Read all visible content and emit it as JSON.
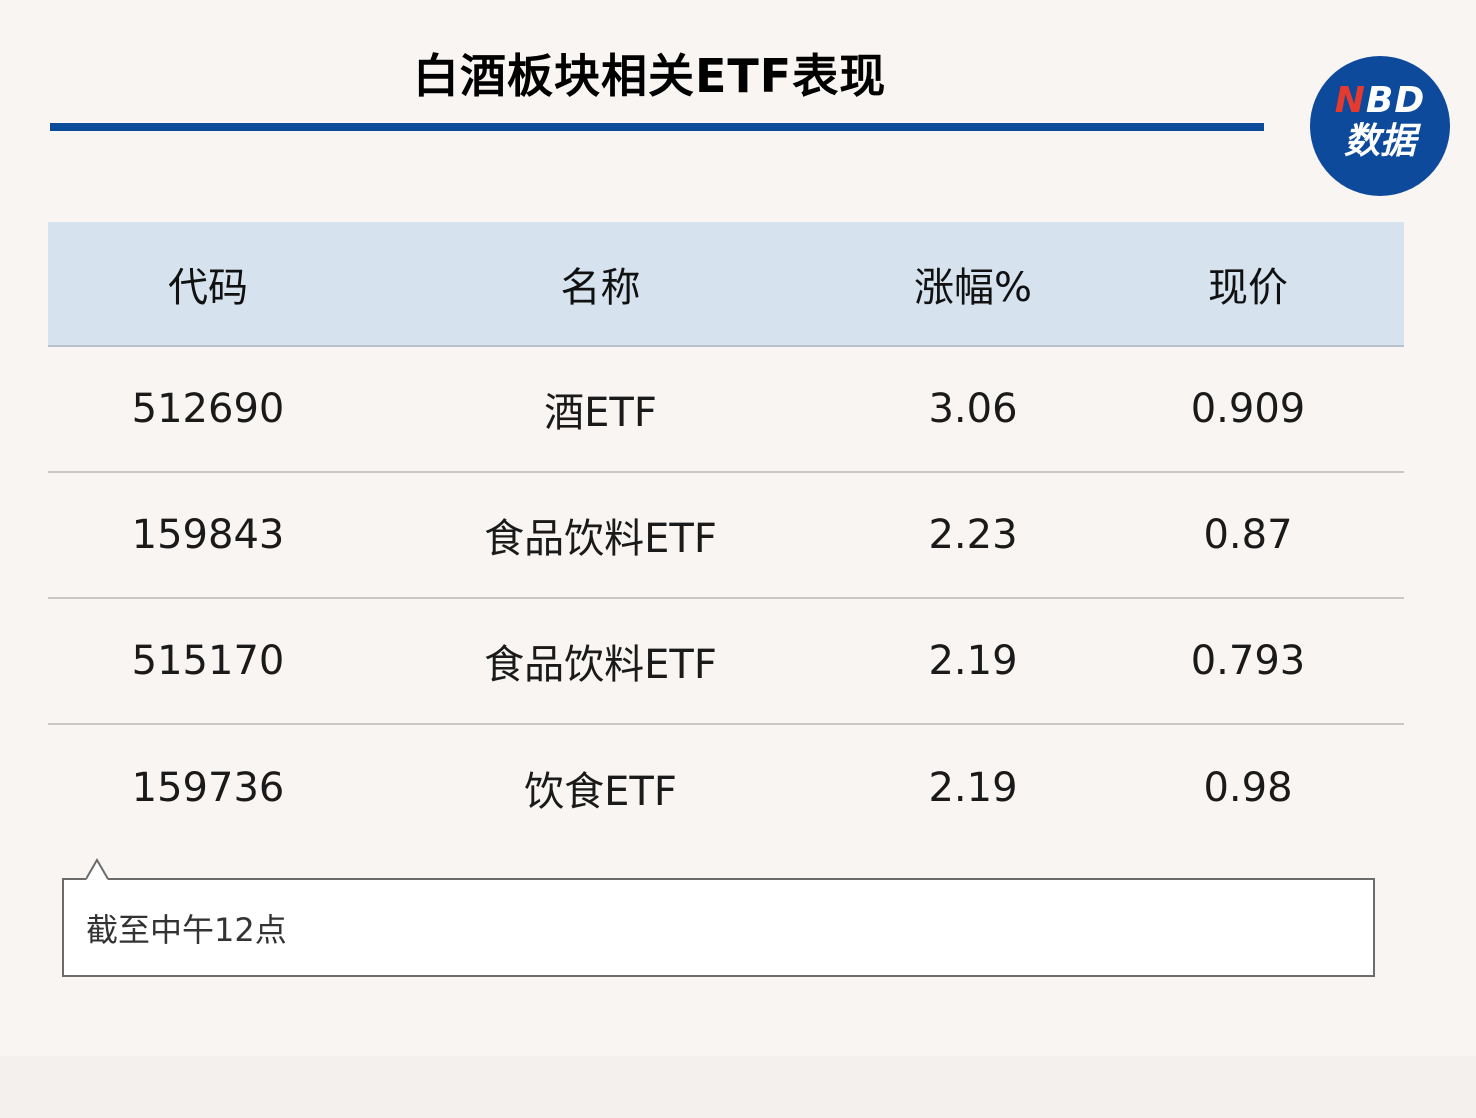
{
  "title": "白酒板块相关ETF表现",
  "logo": {
    "top_first": "N",
    "top_rest": "BD",
    "bottom": "数据"
  },
  "colors": {
    "accent": "#0c4a9a",
    "header_bg": "#d6e3ef",
    "logo_bg": "#0d4a9c",
    "logo_n": "#e63a2e"
  },
  "chart_data": {
    "type": "table",
    "title": "白酒板块相关ETF表现",
    "columns": [
      "代码",
      "名称",
      "涨幅%",
      "现价"
    ],
    "rows": [
      [
        "512690",
        "酒ETF",
        "3.06",
        "0.909"
      ],
      [
        "159843",
        "食品饮料ETF",
        "2.23",
        "0.87"
      ],
      [
        "515170",
        "食品饮料ETF",
        "2.19",
        "0.793"
      ],
      [
        "159736",
        "饮食ETF",
        "2.19",
        "0.98"
      ]
    ]
  },
  "note": "截至中午12点"
}
